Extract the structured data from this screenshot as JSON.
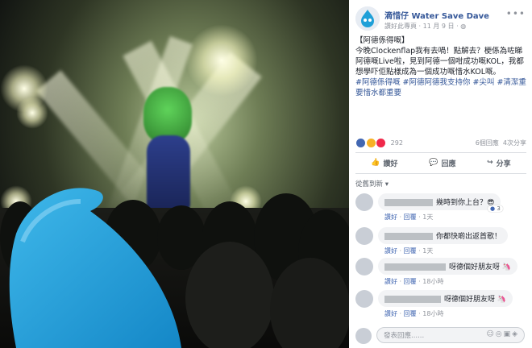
{
  "post": {
    "page_name": "滴惜仔 Water Save Dave",
    "meta_prefix": "讚好此專頁",
    "meta_dot": "·",
    "date": "11 月 9 日",
    "meta_dot2": "·",
    "body_line1": "【阿德係得嘅】",
    "body_line2": "今晚Clockenflap我有去喎！點解去？梗係為咗睇阿德嘅Live啦，見到阿德一個咁成功嘅KOL，我都想學吓佢點樣成為一個成功嘅惜水KOL嘅。",
    "hashtags": "#阿德係得嘅 #阿德阿德我支持你 #尖叫 #清潔重要惜水都重要",
    "reaction_count": "292",
    "comments_count": "6個回應",
    "shares_count": "4次分享",
    "actions": {
      "like": "讚好",
      "comment": "回應",
      "share": "分享"
    },
    "sort_label": "從舊到新 ▾"
  },
  "comments": [
    {
      "text": "幾時到你上台？😎",
      "like": "讚好",
      "reply": "回覆",
      "time": "1天",
      "reaction_count": "3"
    },
    {
      "text": "你都快啲出返首歌！",
      "like": "讚好",
      "reply": "回覆",
      "time": "1天"
    },
    {
      "text": "呀德個好朋友呀 🦄",
      "like": "讚好",
      "reply": "回覆",
      "time": "18小時"
    },
    {
      "text": "呀德個好朋友呀 🦄",
      "like": "讚好",
      "reply": "回覆",
      "time": "18小時"
    }
  ],
  "reply_input": {
    "placeholder": "發表回應......"
  },
  "colors": {
    "link": "#365899",
    "water_drop": "#1fa0d8"
  }
}
